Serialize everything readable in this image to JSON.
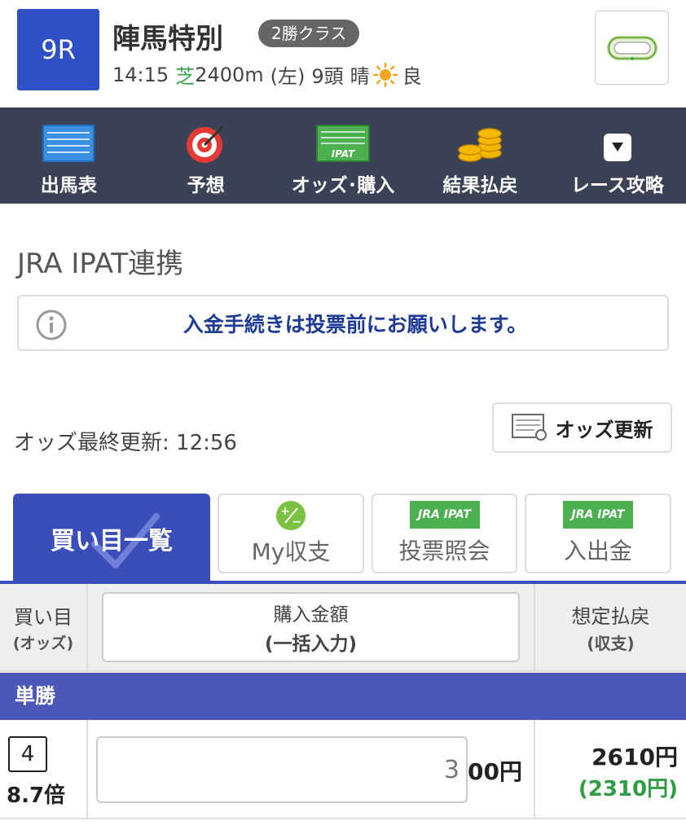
{
  "race": {
    "number": "9R",
    "name": "陣馬特別",
    "class": "2勝クラス",
    "time": "14:15",
    "surface": "芝",
    "distance": "2400m",
    "direction": "(左)",
    "runners": "9頭",
    "weather": "晴",
    "condition": "良"
  },
  "nav": {
    "items": [
      {
        "label": "出馬表",
        "icon": "list-icon"
      },
      {
        "label": "予想",
        "icon": "target-icon"
      },
      {
        "label": "オッズ･購入",
        "icon": "ipat-icon"
      },
      {
        "label": "結果払戻",
        "icon": "coins-icon"
      },
      {
        "label": "レース攻略",
        "icon": "dropdown-icon"
      }
    ]
  },
  "ipat": {
    "title": "JRA IPAT連携",
    "notice": "入金手続きは投票前にお願いします。"
  },
  "odds": {
    "last_updated": "オッズ最終更新: 12:56",
    "refresh_label": "オッズ更新"
  },
  "tabs": [
    {
      "label": "買い目一覧",
      "active": true
    },
    {
      "label": "My収支"
    },
    {
      "label": "投票照会",
      "badge": "JRA IPAT"
    },
    {
      "label": "入出金",
      "badge": "JRA IPAT"
    }
  ],
  "table": {
    "col_buy": "買い目",
    "col_buy_sub": "(オッズ)",
    "col_amount": "購入金額",
    "col_amount_sub": "(一括入力)",
    "col_payout": "想定払戻",
    "col_payout_sub": "(収支)",
    "bet_type": "単勝",
    "rows": [
      {
        "horse": "4",
        "odds": "8.7倍",
        "amount": "3",
        "amount_suffix": "00円",
        "payout": "2610円",
        "profit": "(2310円)"
      }
    ]
  },
  "colors": {
    "race_badge": "#2f4fc7",
    "nav_bg": "#3b4256",
    "active_tab": "#3b4db8",
    "bet_type_bar": "#4b58b8",
    "profit": "#2e9e44",
    "ipat_green": "#4caf50"
  }
}
